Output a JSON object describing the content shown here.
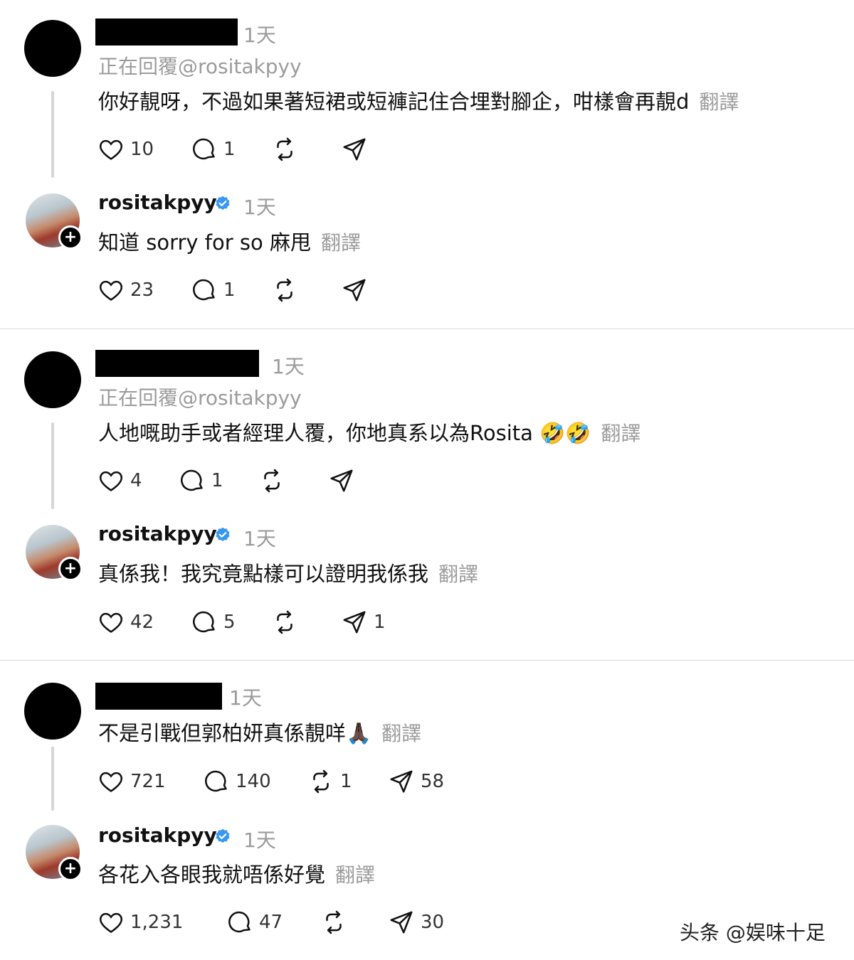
{
  "threads": [
    {
      "comment": {
        "time": "1天",
        "reply_to": "正在回覆@rositakpyy",
        "text": "你好靚呀，不過如果著短裙或短褲記住合埋對腳企，咁樣會再靚d",
        "translate": "翻譯",
        "likes": "10",
        "replies": "1",
        "reposts": "",
        "shares": ""
      },
      "reply": {
        "username": "rositakpyy",
        "time": "1天",
        "text": "知道 sorry for so 麻甩",
        "translate": "翻譯",
        "likes": "23",
        "replies": "1",
        "reposts": "",
        "shares": ""
      }
    },
    {
      "comment": {
        "time": "1天",
        "reply_to": "正在回覆@rositakpyy",
        "text": "人地嘅助手或者經理人覆，你地真系以為Rosita 🤣🤣",
        "translate": "翻譯",
        "likes": "4",
        "replies": "1",
        "reposts": "",
        "shares": ""
      },
      "reply": {
        "username": "rositakpyy",
        "time": "1天",
        "text": "真係我！我究竟點樣可以證明我係我",
        "translate": "翻譯",
        "likes": "42",
        "replies": "5",
        "reposts": "",
        "shares": "1"
      }
    },
    {
      "comment": {
        "time": "1天",
        "text": "不是引戰但郭柏妍真係靚咩🙏🏿",
        "translate": "翻譯",
        "likes": "721",
        "replies": "140",
        "reposts": "1",
        "shares": "58"
      },
      "reply": {
        "username": "rositakpyy",
        "time": "1天",
        "text": "各花入各眼我就唔係好覺",
        "translate": "翻譯",
        "likes": "1,231",
        "replies": "47",
        "reposts": "",
        "shares": "30"
      }
    }
  ],
  "watermark": "头条 @娱味十足",
  "icons": {
    "like": "heart-icon",
    "reply": "comment-icon",
    "repost": "repost-icon",
    "share": "share-icon",
    "verified": "verified-badge-icon",
    "follow": "plus-icon"
  },
  "colors": {
    "verified": "#3897f0",
    "muted": "#9b9b9b",
    "divider": "#d9d9d9"
  }
}
